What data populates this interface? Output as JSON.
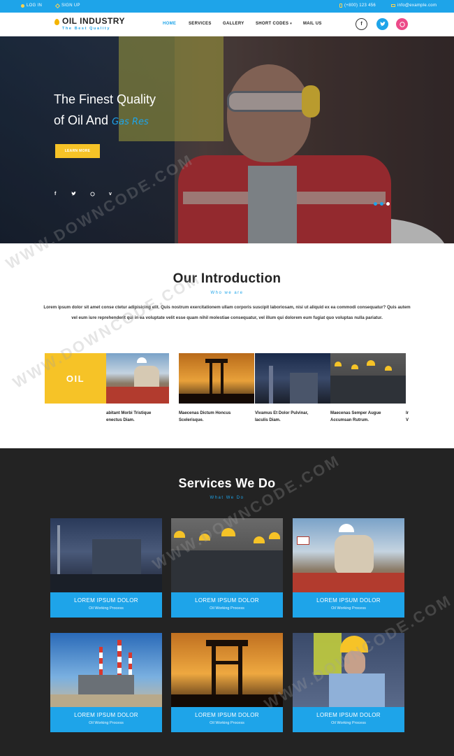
{
  "topbar": {
    "login": "LOG IN",
    "signup": "SIGN UP",
    "phone": "(+800) 123 456",
    "email": "info@example.com"
  },
  "brand": {
    "name": "OIL INDUSTRY",
    "tagline": "The Best Quality",
    "accent": "#1ea4e9",
    "yellow": "#f6c327"
  },
  "nav": {
    "items": [
      "HOME",
      "SERVICES",
      "GALLERY",
      "SHORT CODES",
      "MAIL US"
    ],
    "active": "HOME"
  },
  "header_social": [
    "facebook-icon",
    "twitter-icon",
    "dribbble-icon"
  ],
  "hero": {
    "line1": "The Finest Quality",
    "line2_prefix": "of Oil And",
    "line2_animated": "Gas Res",
    "button": "LEARN MORE",
    "social": [
      "facebook-icon",
      "twitter-icon",
      "dribbble-icon",
      "vimeo-icon"
    ],
    "slides": 3,
    "active_slide": 3
  },
  "intro": {
    "title": "Our Introduction",
    "subtitle": "Who we are",
    "text": "Lorem ipsum dolor sit amet conse ctetur adipisicing elit. Quis nostrum exercitationem ullam corporis suscipit laboriosam, nisi ut aliquid ex ea commodi consequatur? Quis autem vel eum iure reprehenderit qui in ea voluptate velit esse quam nihil molestiae consequatur, vel illum qui dolorem eum fugiat quo voluptas nulla pariatur.",
    "strip_label": "OIL",
    "captions": [
      "abitant Morbi Tristique\nenectus Diam.",
      "Maecenas Dictum Honcus\nScelerisque.",
      "Vivamus Et Dolor Pulvinar,\nIaculis Diam.",
      "Maecenas Semper Augue\nAccumsan Rutrum.",
      "Ir\nV"
    ]
  },
  "services": {
    "title": "Services We Do",
    "subtitle": "What We Do",
    "cards": [
      {
        "title": "LOREM IPSUM DOLOR",
        "sub": "Oil Working Process"
      },
      {
        "title": "LOREM IPSUM DOLOR",
        "sub": "Oil Working Process"
      },
      {
        "title": "LOREM IPSUM DOLOR",
        "sub": "Oil Working Process"
      },
      {
        "title": "LOREM IPSUM DOLOR",
        "sub": "Oil Working Process"
      },
      {
        "title": "LOREM IPSUM DOLOR",
        "sub": "Oil Working Process"
      },
      {
        "title": "LOREM IPSUM DOLOR",
        "sub": "Oil Working Process"
      }
    ]
  },
  "watermark": "WWW.DOWNCODE.COM"
}
